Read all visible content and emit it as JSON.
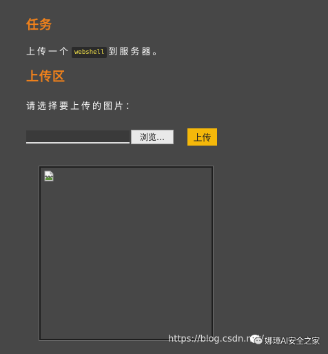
{
  "task": {
    "title": "任务",
    "text_before": "上传一个",
    "code": "webshell",
    "text_after": "到服务器。"
  },
  "upload": {
    "title": "上传区",
    "instruction": "请选择要上传的图片：",
    "browse_label": "浏览…",
    "submit_label": "上传"
  },
  "preview": {
    "icon": "broken-image-icon"
  },
  "watermark": {
    "url": "https://blog.csdn.net/",
    "icon": "wechat-icon",
    "name": "娜璋AI安全之家"
  }
}
